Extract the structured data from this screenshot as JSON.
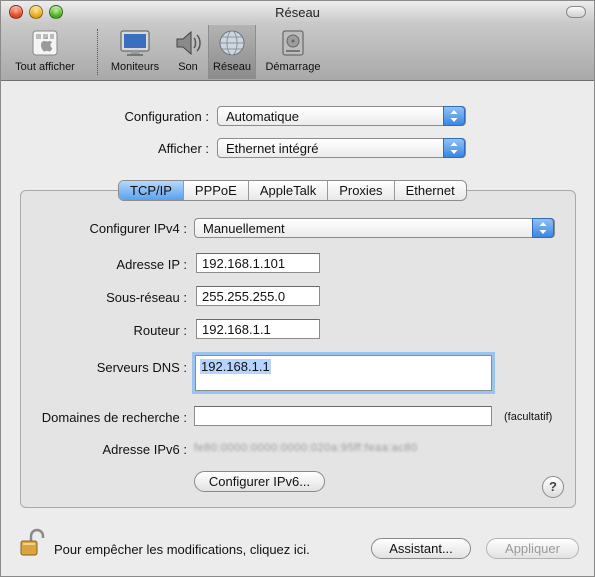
{
  "window": {
    "title": "Réseau"
  },
  "toolbar": {
    "items": [
      {
        "label": "Tout afficher",
        "icon": "apple-grid-icon"
      },
      {
        "label": "Moniteurs",
        "icon": "monitor-icon"
      },
      {
        "label": "Son",
        "icon": "speaker-icon"
      },
      {
        "label": "Réseau",
        "icon": "network-globe-icon",
        "selected": true
      },
      {
        "label": "Démarrage",
        "icon": "hard-drive-icon"
      }
    ]
  },
  "top": {
    "configuration_label": "Configuration :",
    "configuration_value": "Automatique",
    "afficher_label": "Afficher :",
    "afficher_value": "Ethernet intégré"
  },
  "tabs": [
    "TCP/IP",
    "PPPoE",
    "AppleTalk",
    "Proxies",
    "Ethernet"
  ],
  "active_tab": "TCP/IP",
  "tcpip": {
    "configurer_label": "Configurer IPv4 :",
    "configurer_value": "Manuellement",
    "ip_label": "Adresse IP :",
    "ip_value": "192.168.1.101",
    "mask_label": "Sous-réseau :",
    "mask_value": "255.255.255.0",
    "router_label": "Routeur :",
    "router_value": "192.168.1.1",
    "dns_label": "Serveurs DNS :",
    "dns_value": "192.168.1.1",
    "search_label": "Domaines de recherche :",
    "search_value": "",
    "optional_hint": "(facultatif)",
    "ipv6_label": "Adresse IPv6 :",
    "ipv6_value": "fe80:0000:0000:0000:020a:95ff:feaa:ac80",
    "configure_ipv6_button": "Configurer IPv6...",
    "help_button": "?"
  },
  "footer": {
    "lock_text": "Pour empêcher les modifications, cliquez ici.",
    "assistant_button": "Assistant...",
    "apply_button": "Appliquer"
  },
  "colors": {
    "accent": "#3b86e0",
    "selected_tab": "#5aa1ee",
    "focus_ring": "#9cc3ef"
  }
}
